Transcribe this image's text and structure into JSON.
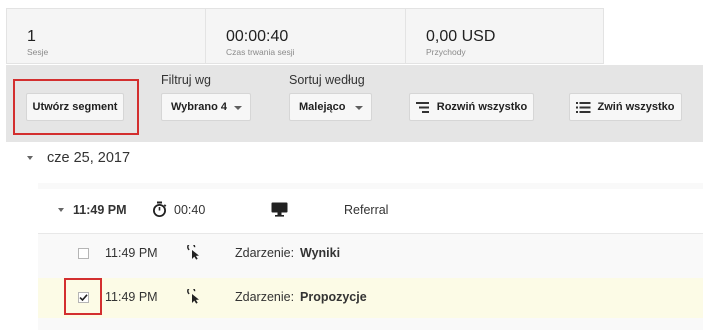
{
  "stats": [
    {
      "value": "1",
      "label": "Sesje"
    },
    {
      "value": "00:00:40",
      "label": "Czas trwania sesji"
    },
    {
      "value": "0,00 USD",
      "label": "Przychody"
    }
  ],
  "toolbar": {
    "create_segment": "Utwórz segment",
    "filter_label": "Filtruj wg",
    "filter_value": "Wybrano 4",
    "sort_label": "Sortuj według",
    "sort_value": "Malejąco",
    "expand_all": "Rozwiń wszystko",
    "collapse_all": "Zwiń wszystko"
  },
  "date_group": {
    "label": "cze 25, 2017"
  },
  "session": {
    "time": "11:49 PM",
    "duration": "00:40",
    "device_icon": "desktop-icon",
    "source": "Referral"
  },
  "events": [
    {
      "time": "11:49 PM",
      "icon": "pointer-click-icon",
      "prefix": "Zdarzenie:",
      "name": "Wyniki",
      "checked": false
    },
    {
      "time": "11:49 PM",
      "icon": "pointer-click-icon",
      "prefix": "Zdarzenie:",
      "name": "Propozycje",
      "checked": true
    }
  ],
  "colors": {
    "highlight": "#d32f2f",
    "selected_row": "#fcfbe6",
    "toolbar_bg": "#e5e5e5"
  }
}
